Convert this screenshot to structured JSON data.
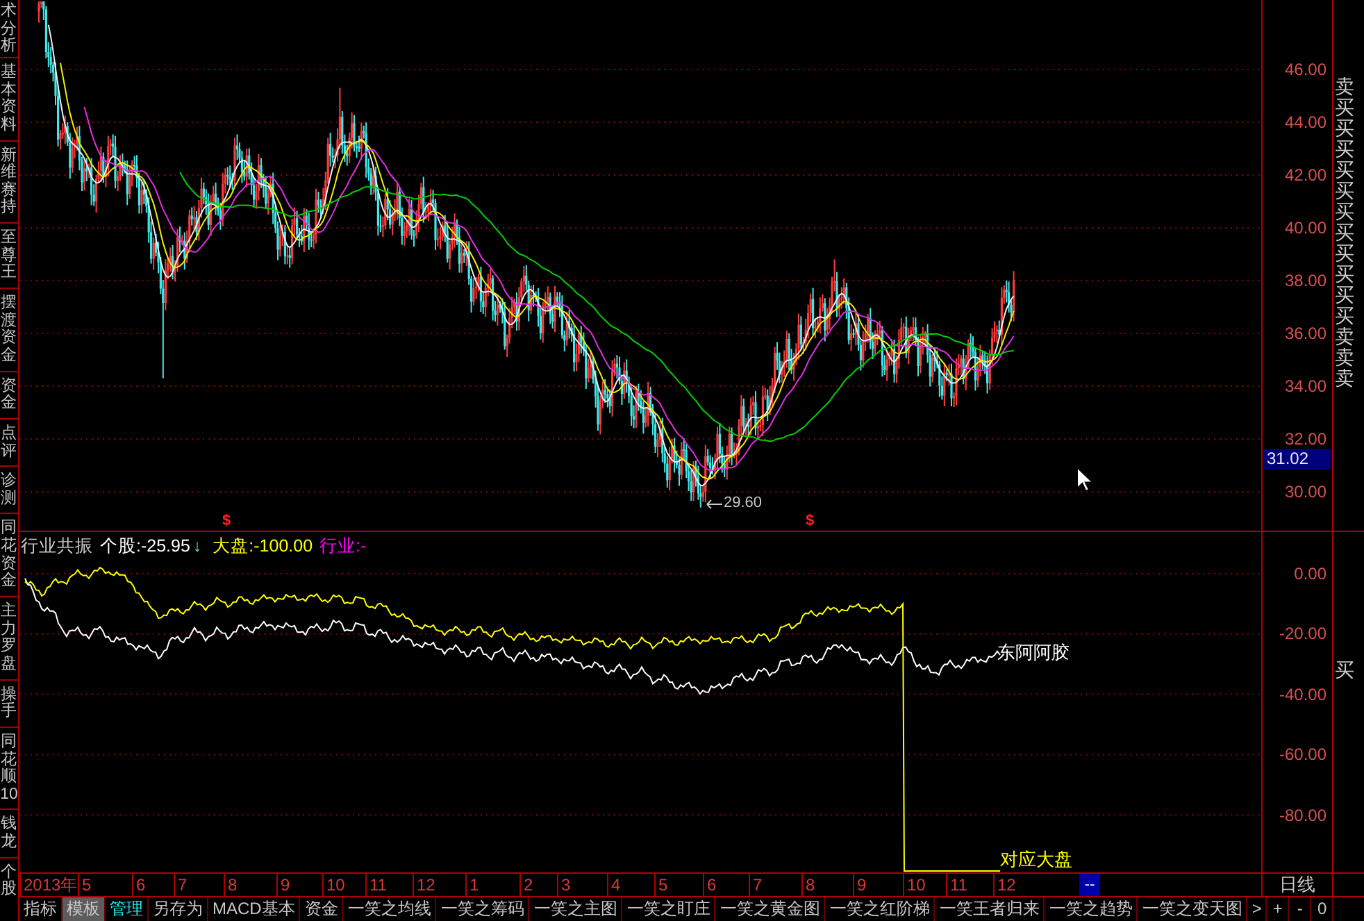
{
  "sidebar": {
    "tabs": [
      "术分析",
      "基本资料",
      "新维赛持",
      "至尊王",
      "摆渡资金",
      "资金",
      "点评",
      "诊测",
      "同花资金",
      "主力罗盘",
      "操手",
      "同花顺10",
      "钱龙",
      "个股"
    ]
  },
  "price_chart": {
    "low_label": "29.60",
    "signal_marks": [
      "$",
      "$"
    ],
    "axis_labels": [
      "46.00",
      "44.00",
      "42.00",
      "40.00",
      "38.00",
      "36.00",
      "34.00",
      "32.00",
      "30.00"
    ],
    "current_price": "31.02",
    "signals": [
      "卖",
      "买",
      "买",
      "买",
      "买",
      "买",
      "买",
      "买",
      "买",
      "买",
      "买",
      "买",
      "卖",
      "卖",
      "卖"
    ]
  },
  "indicator": {
    "title": "行业共振",
    "legend": [
      {
        "text": "个股:-25.95",
        "color": "#ffffff",
        "arrow": "↓",
        "end_label": "东阿阿胶"
      },
      {
        "text": "大盘:-100.00",
        "color": "#ffff00",
        "end_label": "对应大盘"
      },
      {
        "text": "行业:-",
        "color": "#ff00ff"
      }
    ],
    "axis_labels": [
      "0.00",
      "-20.00",
      "-40.00",
      "-60.00",
      "-80.00"
    ],
    "signals": [
      "买"
    ]
  },
  "date_axis": {
    "labels": [
      "2013年",
      "5",
      "6",
      "7",
      "8",
      "9",
      "10",
      "11",
      "12",
      "1",
      "2",
      "3",
      "4",
      "5",
      "6",
      "7",
      "8",
      "9",
      "10",
      "11",
      "12"
    ],
    "cursor": "--",
    "period": "日线"
  },
  "toolbar": {
    "tabs": [
      {
        "label": "指标",
        "kind": "tab",
        "selected": false
      },
      {
        "label": "模板",
        "kind": "tab",
        "selected": true
      },
      {
        "label": "管理",
        "kind": "link",
        "selected": false
      },
      {
        "label": "另存为",
        "kind": "tab",
        "selected": false
      },
      {
        "label": "MACD基本",
        "kind": "tab",
        "selected": false
      },
      {
        "label": "资金",
        "kind": "tab",
        "selected": false
      },
      {
        "label": "一笑之均线",
        "kind": "tab",
        "selected": false
      },
      {
        "label": "一笑之筹码",
        "kind": "tab",
        "selected": false
      },
      {
        "label": "一笑之主图",
        "kind": "tab",
        "selected": false
      },
      {
        "label": "一笑之盯庄",
        "kind": "tab",
        "selected": false
      },
      {
        "label": "一笑之黄金图",
        "kind": "tab",
        "selected": false
      },
      {
        "label": "一笑之红阶梯",
        "kind": "tab",
        "selected": false
      },
      {
        "label": "一笑王者归来",
        "kind": "tab",
        "selected": false
      },
      {
        "label": "一笑之趋势",
        "kind": "tab",
        "selected": false
      },
      {
        "label": "一笑之变天图",
        "kind": "tab",
        "selected": false
      }
    ],
    "buttons": [
      ">",
      "+",
      "-",
      "0"
    ]
  }
}
